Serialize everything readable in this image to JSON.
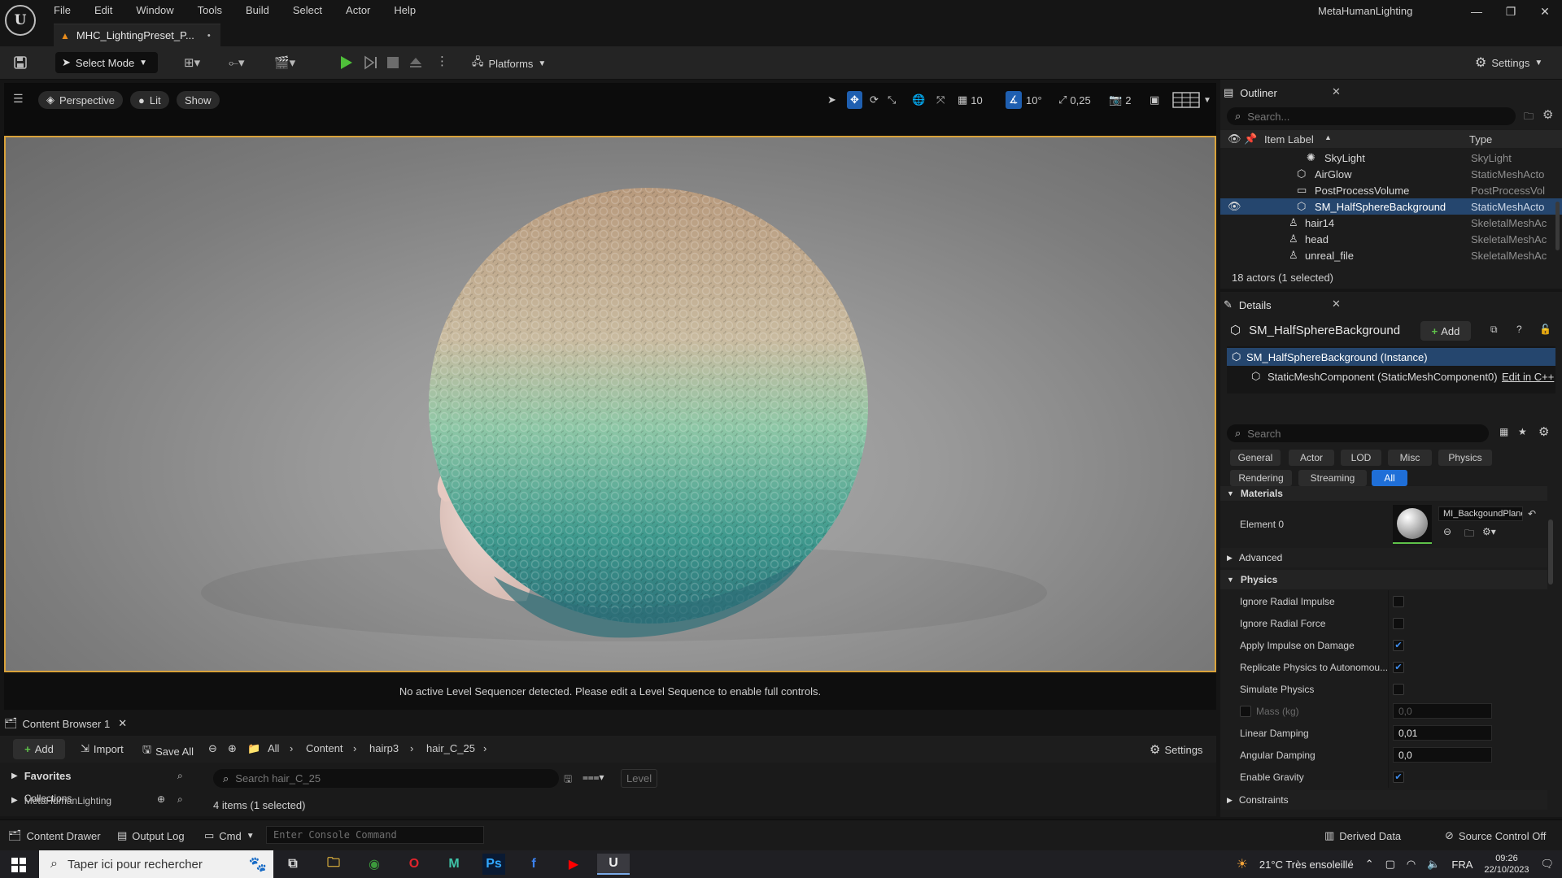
{
  "app": {
    "project": "MetaHumanLighting",
    "menu": [
      "File",
      "Edit",
      "Window",
      "Tools",
      "Build",
      "Select",
      "Actor",
      "Help"
    ],
    "doc_tab": "MHC_LightingPreset_P...",
    "doc_tab_dirty": "•"
  },
  "toolbar": {
    "select_mode": "Select Mode",
    "platforms": "Platforms",
    "settings": "Settings"
  },
  "viewport": {
    "perspective": "Perspective",
    "lit": "Lit",
    "show": "Show",
    "grid_size": "10",
    "rot_snap": "10°",
    "scale_snap": "0,25",
    "camera_speed": "2",
    "sequencer_msg": "No active Level Sequencer detected. Please edit a Level Sequence to enable full controls."
  },
  "content_browser": {
    "tab": "Content Browser 1",
    "add": "Add",
    "import": "Import",
    "save_all": "Save All",
    "settings": "Settings",
    "breadcrumbs": [
      "All",
      "Content",
      "hairp3",
      "hair_C_25"
    ],
    "favorites": "Favorites",
    "collections": "Collections",
    "project_folder": "MetaHumanLighting",
    "search_placeholder": "Search hair_C_25",
    "level_filter": "Level",
    "items_count": "4 items (1 selected)"
  },
  "statusbar": {
    "content_drawer": "Content Drawer",
    "output_log": "Output Log",
    "cmd": "Cmd",
    "console_placeholder": "Enter Console Command",
    "derived_data": "Derived Data",
    "source_control": "Source Control Off"
  },
  "outliner": {
    "title": "Outliner",
    "search_placeholder": "Search...",
    "col_label": "Item Label",
    "col_type": "Type",
    "rows": [
      {
        "label": "SkyLight",
        "type": "SkyLight"
      },
      {
        "label": "AirGlow",
        "type": "StaticMeshActo"
      },
      {
        "label": "PostProcessVolume",
        "type": "PostProcessVol"
      },
      {
        "label": "SM_HalfSphereBackground",
        "type": "StaticMeshActo"
      },
      {
        "label": "hair14",
        "type": "SkeletalMeshAc"
      },
      {
        "label": "head",
        "type": "SkeletalMeshAc"
      },
      {
        "label": "unreal_file",
        "type": "SkeletalMeshAc"
      }
    ],
    "status": "18 actors (1 selected)"
  },
  "details": {
    "title": "Details",
    "actor": "SM_HalfSphereBackground",
    "add": "Add",
    "instance": "SM_HalfSphereBackground (Instance)",
    "component": "StaticMeshComponent (StaticMeshComponent0)",
    "edit_cpp": "Edit in C++",
    "search_placeholder": "Search",
    "filters": [
      "General",
      "Actor",
      "LOD",
      "Misc",
      "Physics",
      "Rendering",
      "Streaming",
      "All"
    ],
    "materials": {
      "header": "Materials",
      "element": "Element 0",
      "material_name": "MI_BackgoundPlane"
    },
    "advanced": "Advanced",
    "physics": {
      "header": "Physics",
      "ignore_radial_impulse": "Ignore Radial Impulse",
      "ignore_radial_force": "Ignore Radial Force",
      "apply_impulse": "Apply Impulse on Damage",
      "replicate": "Replicate Physics to Autonomou...",
      "simulate": "Simulate Physics",
      "mass": "Mass (kg)",
      "mass_value": "0,0",
      "linear_damping": "Linear Damping",
      "linear_damping_value": "0,01",
      "angular_damping": "Angular Damping",
      "angular_damping_value": "0,0",
      "enable_gravity": "Enable Gravity"
    },
    "constraints": "Constraints"
  },
  "taskbar": {
    "search": "Taper ici pour rechercher",
    "weather": "21°C  Très ensoleillé",
    "lang": "FRA",
    "time": "09:26",
    "date": "22/10/2023"
  },
  "colors": {
    "selection": "#25466e",
    "accent": "#1f6fd8",
    "viewport_border": "#d9a23a"
  }
}
